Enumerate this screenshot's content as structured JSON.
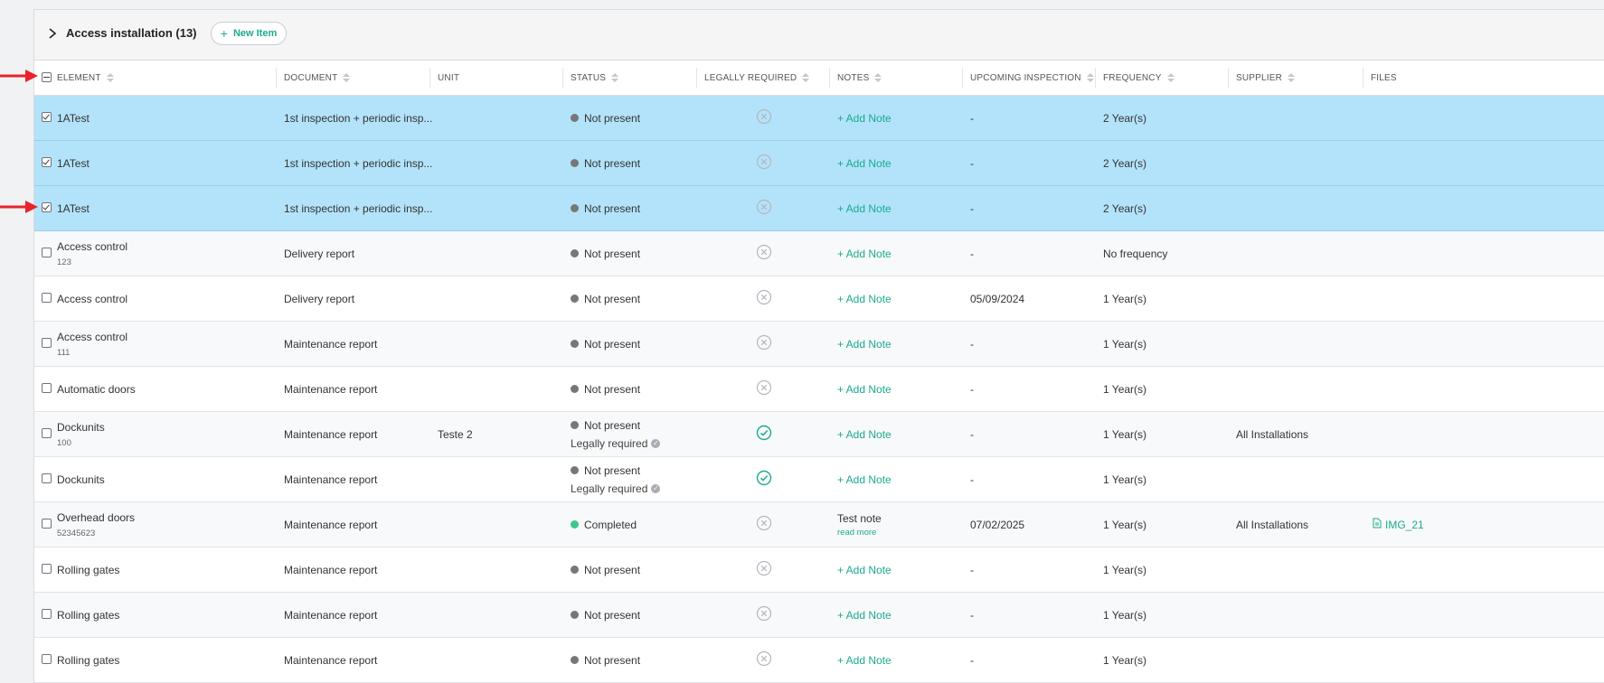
{
  "group": {
    "title": "Access installation (13)",
    "new_item_label": "New Item"
  },
  "columns": [
    "ELEMENT",
    "DOCUMENT",
    "UNIT",
    "STATUS",
    "LEGALLY REQUIRED",
    "NOTES",
    "UPCOMING INSPECTION",
    "FREQUENCY",
    "SUPPLIER",
    "FILES"
  ],
  "rows": [
    {
      "element": "1ATest",
      "sub": "",
      "document": "1st inspection + periodic insp...",
      "unit": "",
      "status": "Not present",
      "status_note": "",
      "legally_required": false,
      "notes": "+ Add Note",
      "read_more": "",
      "upcoming": "-",
      "frequency": "2 Year(s)",
      "supplier": "",
      "file": ""
    },
    {
      "element": "1ATest",
      "sub": "",
      "document": "1st inspection + periodic insp...",
      "unit": "",
      "status": "Not present",
      "status_note": "",
      "legally_required": false,
      "notes": "+ Add Note",
      "read_more": "",
      "upcoming": "-",
      "frequency": "2 Year(s)",
      "supplier": "",
      "file": ""
    },
    {
      "element": "1ATest",
      "sub": "",
      "document": "1st inspection + periodic insp...",
      "unit": "",
      "status": "Not present",
      "status_note": "",
      "legally_required": false,
      "notes": "+ Add Note",
      "read_more": "",
      "upcoming": "-",
      "frequency": "2 Year(s)",
      "supplier": "",
      "file": ""
    },
    {
      "element": "Access control",
      "sub": "123",
      "document": "Delivery report",
      "unit": "",
      "status": "Not present",
      "status_note": "",
      "legally_required": false,
      "notes": "+ Add Note",
      "read_more": "",
      "upcoming": "-",
      "frequency": "No frequency",
      "supplier": "",
      "file": ""
    },
    {
      "element": "Access control",
      "sub": "",
      "document": "Delivery report",
      "unit": "",
      "status": "Not present",
      "status_note": "",
      "legally_required": false,
      "notes": "+ Add Note",
      "read_more": "",
      "upcoming": "05/09/2024",
      "frequency": "1 Year(s)",
      "supplier": "",
      "file": ""
    },
    {
      "element": "Access control",
      "sub": "111",
      "document": "Maintenance report",
      "unit": "",
      "status": "Not present",
      "status_note": "",
      "legally_required": false,
      "notes": "+ Add Note",
      "read_more": "",
      "upcoming": "-",
      "frequency": "1 Year(s)",
      "supplier": "",
      "file": ""
    },
    {
      "element": "Automatic doors",
      "sub": "",
      "document": "Maintenance report",
      "unit": "",
      "status": "Not present",
      "status_note": "",
      "legally_required": false,
      "notes": "+ Add Note",
      "read_more": "",
      "upcoming": "-",
      "frequency": "1 Year(s)",
      "supplier": "",
      "file": ""
    },
    {
      "element": "Dockunits",
      "sub": "100",
      "document": "Maintenance report",
      "unit": "Teste 2",
      "status": "Not present",
      "status_note": "Legally required",
      "legally_required": true,
      "notes": "+ Add Note",
      "read_more": "",
      "upcoming": "-",
      "frequency": "1 Year(s)",
      "supplier": "All Installations",
      "file": ""
    },
    {
      "element": "Dockunits",
      "sub": "",
      "document": "Maintenance report",
      "unit": "",
      "status": "Not present",
      "status_note": "Legally required",
      "legally_required": true,
      "notes": "+ Add Note",
      "read_more": "",
      "upcoming": "-",
      "frequency": "1 Year(s)",
      "supplier": "",
      "file": ""
    },
    {
      "element": "Overhead doors",
      "sub": "52345623",
      "document": "Maintenance report",
      "unit": "",
      "status": "Completed",
      "status_note": "",
      "legally_required": false,
      "notes": "Test note",
      "read_more": "read more",
      "upcoming": "07/02/2025",
      "frequency": "1 Year(s)",
      "supplier": "All Installations",
      "file": "IMG_21"
    },
    {
      "element": "Rolling gates",
      "sub": "",
      "document": "Maintenance report",
      "unit": "",
      "status": "Not present",
      "status_note": "",
      "legally_required": false,
      "notes": "+ Add Note",
      "read_more": "",
      "upcoming": "-",
      "frequency": "1 Year(s)",
      "supplier": "",
      "file": ""
    },
    {
      "element": "Rolling gates",
      "sub": "",
      "document": "Maintenance report",
      "unit": "",
      "status": "Not present",
      "status_note": "",
      "legally_required": false,
      "notes": "+ Add Note",
      "read_more": "",
      "upcoming": "-",
      "frequency": "1 Year(s)",
      "supplier": "",
      "file": ""
    },
    {
      "element": "Rolling gates",
      "sub": "",
      "document": "Maintenance report",
      "unit": "",
      "status": "Not present",
      "status_note": "",
      "legally_required": false,
      "notes": "+ Add Note",
      "read_more": "",
      "upcoming": "-",
      "frequency": "1 Year(s)",
      "supplier": "",
      "file": ""
    }
  ],
  "selected_rows": [
    0,
    1,
    2
  ],
  "colors": {
    "selected_row": "#b3e3fa",
    "accent": "#1aaa8f",
    "annotation_arrow": "#e8232a",
    "status_completed": "#3cc88a",
    "status_not_present": "#777777"
  }
}
